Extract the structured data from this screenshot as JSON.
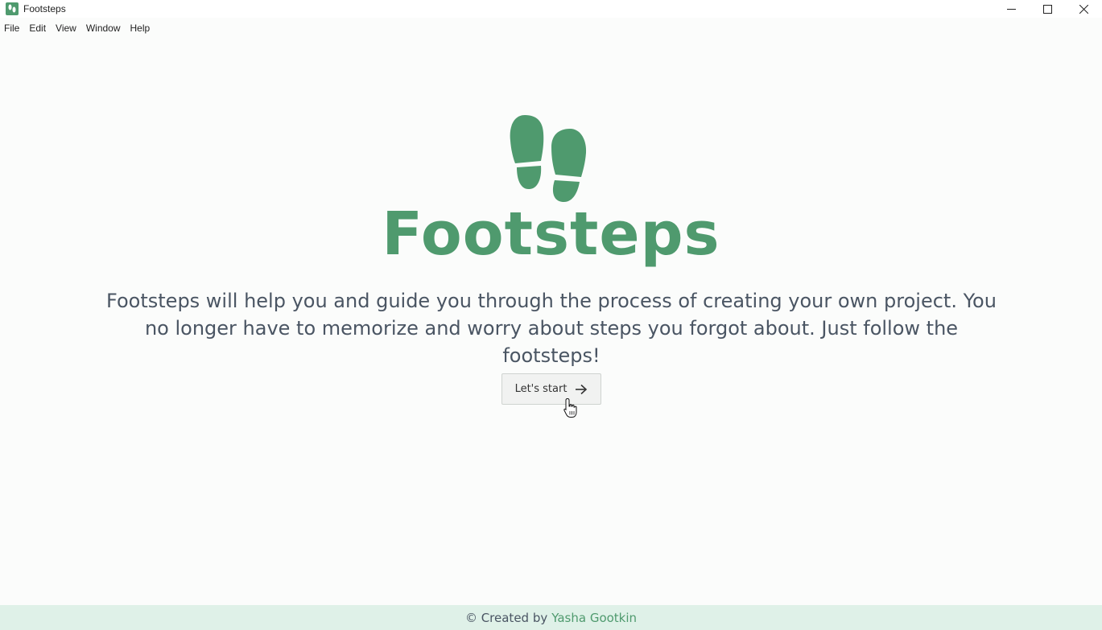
{
  "window": {
    "title": "Footsteps",
    "controls": [
      "minimize-icon",
      "maximize-icon",
      "close-icon"
    ]
  },
  "menu": {
    "items": [
      {
        "label": "File"
      },
      {
        "label": "Edit"
      },
      {
        "label": "View"
      },
      {
        "label": "Window"
      },
      {
        "label": "Help"
      }
    ]
  },
  "hero": {
    "logo_icon": "footsteps-icon",
    "title": "Footsteps",
    "description": "Footsteps will help you and guide you through the process of creating your own project. You no longer have to memorize and worry about steps you forgot about. Just follow the footsteps!",
    "start_button": "Let's start",
    "start_icon": "arrow-right-icon"
  },
  "footer": {
    "prefix": "© Created by",
    "author": "Yasha Gootkin"
  },
  "colors": {
    "accent": "#4f9a6e",
    "text": "#4a5563",
    "footer_bg": "#dff1e8",
    "background": "#fbfcfb"
  }
}
